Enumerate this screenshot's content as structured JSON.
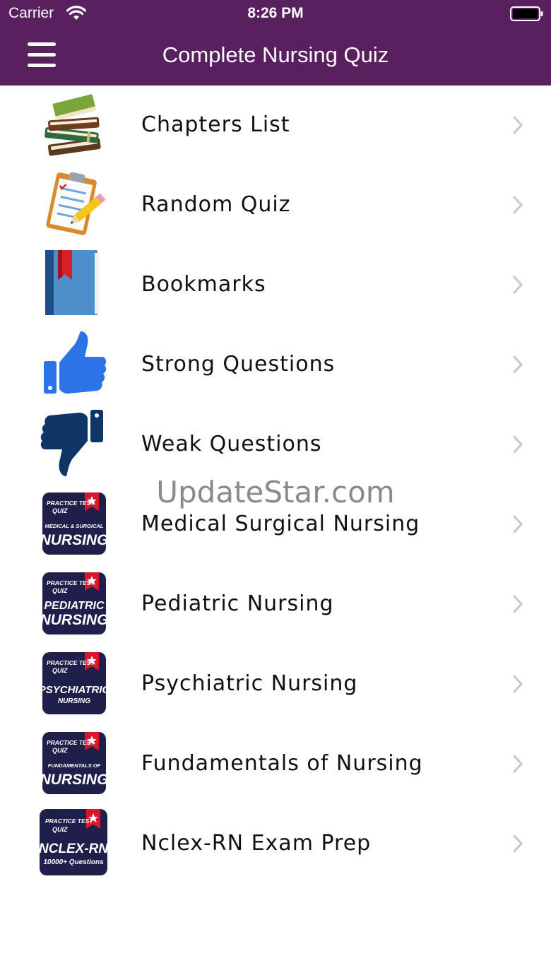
{
  "status_bar": {
    "carrier": "Carrier",
    "time": "8:26 PM",
    "icons": [
      "wifi-icon",
      "battery-icon"
    ]
  },
  "nav": {
    "title": "Complete Nursing Quiz",
    "menu_icon": "hamburger-icon"
  },
  "colors": {
    "brand": "#58205f",
    "badge": "#1e1f4a",
    "badge_ribbon": "#d9162b",
    "thumbs_up": "#2d73e8",
    "thumbs_down": "#0e3566",
    "chevron": "#c7c7cc"
  },
  "menu": [
    {
      "label": "Chapters List",
      "icon": "books-icon"
    },
    {
      "label": "Random Quiz",
      "icon": "clipboard-pencil-icon"
    },
    {
      "label": "Bookmarks",
      "icon": "bookmark-book-icon"
    },
    {
      "label": "Strong Questions",
      "icon": "thumbs-up-icon"
    },
    {
      "label": "Weak Questions",
      "icon": "thumbs-down-icon"
    },
    {
      "label": "Medical Surgical Nursing",
      "icon": "app-badge-icon",
      "badge": [
        "PRACTICE TEST",
        "QUIZ",
        "MEDICAL & SURGICAL",
        "NURSING"
      ]
    },
    {
      "label": "Pediatric Nursing",
      "icon": "app-badge-icon",
      "badge": [
        "PRACTICE TEST",
        "QUIZ",
        "PEDIATRIC",
        "NURSING"
      ]
    },
    {
      "label": "Psychiatric Nursing",
      "icon": "app-badge-icon",
      "badge": [
        "PRACTICE TEST",
        "QUIZ",
        "PSYCHIATRIC",
        "NURSING"
      ]
    },
    {
      "label": "Fundamentals of Nursing",
      "icon": "app-badge-icon",
      "badge": [
        "PRACTICE TEST",
        "QUIZ",
        "FUNDAMENTALS OF",
        "NURSING"
      ]
    },
    {
      "label": "Nclex-RN Exam Prep",
      "icon": "app-badge-icon",
      "badge": [
        "PRACTICE TEST",
        "QUIZ",
        "NCLEX-RN",
        "10000+ Questions"
      ]
    }
  ],
  "watermark": "UpdateStar.com"
}
